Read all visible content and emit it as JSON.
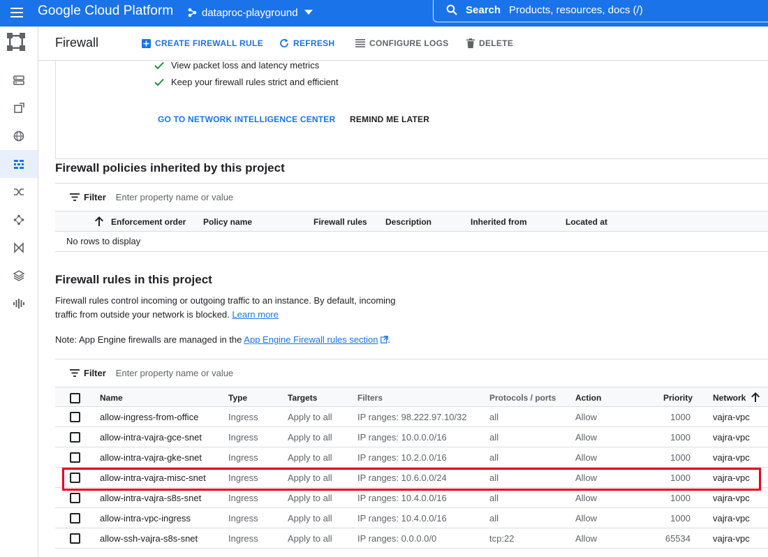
{
  "topbar": {
    "product": "Google Cloud Platform",
    "project": "dataproc-playground",
    "search_label": "Search",
    "search_placeholder": "Products, resources, docs (/)"
  },
  "toolbar": {
    "title": "Firewall",
    "create_label": "CREATE FIREWALL RULE",
    "refresh_label": "REFRESH",
    "configure_logs_label": "CONFIGURE LOGS",
    "delete_label": "DELETE"
  },
  "banner": {
    "check1": "View packet loss and latency metrics",
    "check2": "Keep your firewall rules strict and efficient",
    "go_label": "GO TO NETWORK INTELLIGENCE CENTER",
    "remind_label": "REMIND ME LATER"
  },
  "policies": {
    "heading": "Firewall policies inherited by this project",
    "filter_label": "Filter",
    "filter_placeholder": "Enter property name or value",
    "columns": [
      "Enforcement order",
      "Policy name",
      "Firewall rules",
      "Description",
      "Inherited from",
      "Located at"
    ],
    "empty": "No rows to display"
  },
  "rules": {
    "heading": "Firewall rules in this project",
    "desc1": "Firewall rules control incoming or outgoing traffic to an instance. By default, incoming",
    "desc2_prefix": "traffic from outside your network is blocked.",
    "learn_more": "Learn more",
    "note_prefix": "Note: App Engine firewalls are managed in the",
    "note_link": "App Engine Firewall rules section",
    "note_suffix": ".",
    "filter_label": "Filter",
    "filter_placeholder": "Enter property name or value",
    "columns": {
      "name": "Name",
      "type": "Type",
      "targets": "Targets",
      "filters": "Filters",
      "protocols": "Protocols / ports",
      "action": "Action",
      "priority": "Priority",
      "network": "Network"
    },
    "rows": [
      {
        "name": "allow-ingress-from-office",
        "type": "Ingress",
        "targets": "Apply to all",
        "filters": "IP ranges: 98.222.97.10/32",
        "protocols": "all",
        "action": "Allow",
        "priority": "1000",
        "network": "vajra-vpc"
      },
      {
        "name": "allow-intra-vajra-gce-snet",
        "type": "Ingress",
        "targets": "Apply to all",
        "filters": "IP ranges: 10.0.0.0/16",
        "protocols": "all",
        "action": "Allow",
        "priority": "1000",
        "network": "vajra-vpc"
      },
      {
        "name": "allow-intra-vajra-gke-snet",
        "type": "Ingress",
        "targets": "Apply to all",
        "filters": "IP ranges: 10.2.0.0/16",
        "protocols": "all",
        "action": "Allow",
        "priority": "1000",
        "network": "vajra-vpc"
      },
      {
        "name": "allow-intra-vajra-misc-snet",
        "type": "Ingress",
        "targets": "Apply to all",
        "filters": "IP ranges: 10.6.0.0/24",
        "protocols": "all",
        "action": "Allow",
        "priority": "1000",
        "network": "vajra-vpc"
      },
      {
        "name": "allow-intra-vajra-s8s-snet",
        "type": "Ingress",
        "targets": "Apply to all",
        "filters": "IP ranges: 10.4.0.0/16",
        "protocols": "all",
        "action": "Allow",
        "priority": "1000",
        "network": "vajra-vpc"
      },
      {
        "name": "allow-intra-vpc-ingress",
        "type": "Ingress",
        "targets": "Apply to all",
        "filters": "IP ranges: 10.4.0.0/16",
        "protocols": "all",
        "action": "Allow",
        "priority": "1000",
        "network": "vajra-vpc"
      },
      {
        "name": "allow-ssh-vajra-s8s-snet",
        "type": "Ingress",
        "targets": "Apply to all",
        "filters": "IP ranges: 0.0.0.0/0",
        "protocols": "tcp:22",
        "action": "Allow",
        "priority": "65534",
        "network": "vajra-vpc"
      }
    ]
  },
  "colors": {
    "brand_blue": "#1a73e8",
    "highlight_red": "#e8001c",
    "check_green": "#1e8e3e"
  },
  "icons": [
    "menu-icon",
    "project-icon",
    "search-icon",
    "add-box-icon",
    "refresh-icon",
    "list-icon",
    "trash-icon",
    "check-icon",
    "filter-icon",
    "arrow-up-icon",
    "external-link-icon"
  ]
}
